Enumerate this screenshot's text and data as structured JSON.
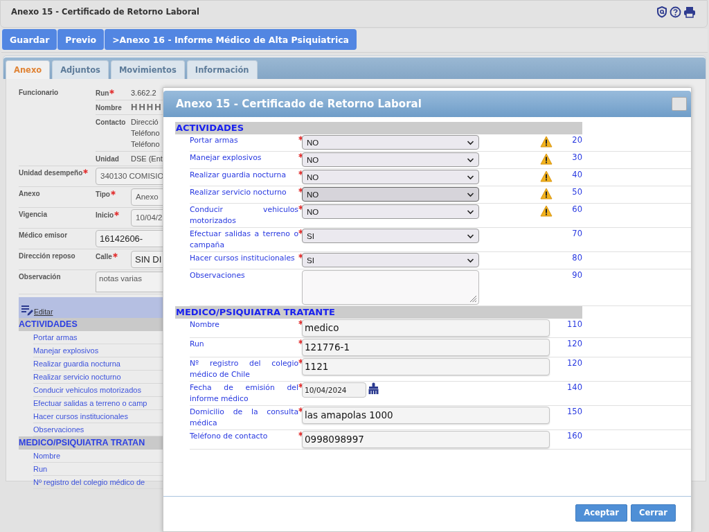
{
  "header": {
    "title": "Anexo 15 - Certificado de Retorno Laboral"
  },
  "toolbar": [
    {
      "label": "Guardar"
    },
    {
      "label": "Previo"
    },
    {
      "label": ">Anexo 16 - Informe Médico de Alta Psiquiatrica"
    }
  ],
  "tabs": [
    {
      "label": "Anexo",
      "selected": true
    },
    {
      "label": "Adjuntos",
      "selected": false
    },
    {
      "label": "Movimientos",
      "selected": false
    },
    {
      "label": "Información",
      "selected": false
    }
  ],
  "form": [
    {
      "label": "Funcionario",
      "required": false,
      "items": [
        {
          "label": "Run",
          "required": true,
          "kind": "text",
          "values": [
            "3.662.2"
          ]
        },
        {
          "label": "Nombre",
          "required": false,
          "kind": "large",
          "values": [
            "HHHH"
          ]
        },
        {
          "label": "Contacto",
          "required": false,
          "kind": "text",
          "values": [
            "Direcció",
            "Teléfono",
            "Teléfono"
          ]
        },
        {
          "label": "Unidad",
          "required": false,
          "kind": "text",
          "values": [
            "DSE (Ent"
          ]
        }
      ]
    },
    {
      "label": "Unidad desempeño",
      "required": true,
      "items": [
        {
          "kind": "field",
          "values": [
            "340130 COMISIO"
          ]
        }
      ]
    },
    {
      "label": "Anexo",
      "required": false,
      "items": [
        {
          "label": "Tipo",
          "required": true,
          "kind": "field",
          "values": [
            "Anexo"
          ]
        }
      ]
    },
    {
      "label": "Vigencia",
      "required": false,
      "items": [
        {
          "label": "Inicio",
          "required": true,
          "kind": "field",
          "values": [
            "10/04/2"
          ]
        }
      ]
    },
    {
      "label": "Médico emisor",
      "required": false,
      "items": [
        {
          "kind": "field-large",
          "values": [
            "16142606-"
          ]
        }
      ]
    },
    {
      "label": "Dirección reposo",
      "required": false,
      "items": [
        {
          "label": "Calle",
          "required": true,
          "kind": "field-large",
          "values": [
            "SIN DI"
          ]
        }
      ]
    },
    {
      "label": "Observación",
      "required": false,
      "items": [
        {
          "kind": "textarea",
          "values": [
            "notas varias"
          ]
        }
      ]
    }
  ],
  "edit_link": "Editar",
  "summary": [
    {
      "heading": "ACTIVIDADES",
      "items": [
        "Portar armas",
        "Manejar explosivos",
        "Realizar guardia nocturna",
        "Realizar servicio nocturno",
        "Conducir vehiculos motorizados",
        "Efectuar salidas a terreno o camp",
        "Hacer cursos institucionales",
        "Observaciones"
      ]
    },
    {
      "heading": "MEDICO/PSIQUIATRA TRATAN",
      "items": [
        "Nombre",
        "Run",
        "Nº registro del colegio médico de"
      ]
    }
  ],
  "dialog": {
    "title": "Anexo 15 - Certificado de Retorno Laboral",
    "sections": [
      {
        "heading": "ACTIVIDADES",
        "rows": [
          {
            "label": "Portar armas",
            "required": true,
            "kind": "select",
            "value": "NO",
            "warning": true,
            "focused": false,
            "number": "20"
          },
          {
            "label": "Manejar explosivos",
            "required": true,
            "kind": "select",
            "value": "NO",
            "warning": true,
            "focused": false,
            "number": "30"
          },
          {
            "label": "Realizar guardia nocturna",
            "required": true,
            "kind": "select",
            "value": "NO",
            "warning": true,
            "focused": false,
            "number": "40"
          },
          {
            "label": "Realizar servicio nocturno",
            "required": true,
            "kind": "select",
            "value": "NO",
            "warning": true,
            "focused": true,
            "number": "50"
          },
          {
            "label": "Conducir vehiculos motorizados",
            "required": true,
            "kind": "select",
            "value": "NO",
            "warning": true,
            "focused": false,
            "number": "60"
          },
          {
            "label": "Efectuar salidas a terreno o campaña",
            "required": true,
            "kind": "select",
            "value": "SI",
            "warning": false,
            "focused": false,
            "number": "70"
          },
          {
            "label": "Hacer cursos institucionales",
            "required": true,
            "kind": "select",
            "value": "SI",
            "warning": false,
            "focused": false,
            "number": "80"
          },
          {
            "label": "Observaciones",
            "required": false,
            "kind": "textarea",
            "warning": false,
            "focused": false,
            "number": "90"
          }
        ]
      },
      {
        "heading": "MEDICO/PSIQUIATRA TRATANTE",
        "rows": [
          {
            "label": "Nombre",
            "required": true,
            "kind": "text",
            "value": "medico",
            "warning": false,
            "focused": false,
            "number": "110"
          },
          {
            "label": "Run",
            "required": true,
            "kind": "text",
            "value": "121776-1",
            "warning": false,
            "focused": false,
            "number": "120"
          },
          {
            "label": "Nº registro del colegio médico de Chile",
            "required": true,
            "kind": "text",
            "value": "1121",
            "warning": false,
            "focused": false,
            "number": "120"
          },
          {
            "label": "Fecha de emisión del informe médico",
            "required": true,
            "kind": "date",
            "value": "10/04/2024",
            "warning": false,
            "focused": false,
            "number": "140"
          },
          {
            "label": "Domicilio de la consulta médica",
            "required": true,
            "kind": "text",
            "value": "las amapolas 1000",
            "warning": false,
            "focused": false,
            "number": "150"
          },
          {
            "label": "Teléfono de contacto",
            "required": true,
            "kind": "text",
            "value": "0998098997",
            "warning": false,
            "focused": false,
            "number": "160"
          }
        ]
      }
    ],
    "buttons": [
      {
        "label": "Aceptar"
      },
      {
        "label": "Cerrar"
      }
    ]
  }
}
